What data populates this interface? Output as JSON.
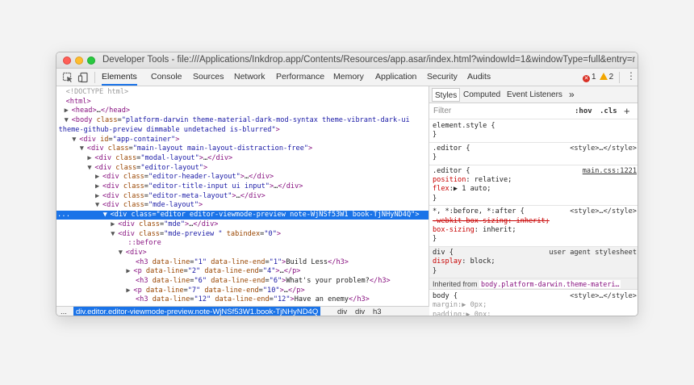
{
  "window": {
    "title": "Developer Tools - file:///Applications/Inkdrop.app/Contents/Resources/app.asar/index.html?windowId=1&windowType=full&entry=main&no..."
  },
  "toolbar": {
    "tabs": [
      "Elements",
      "Console",
      "Sources",
      "Network",
      "Performance",
      "Memory",
      "Application",
      "Security",
      "Audits"
    ],
    "errors": "1",
    "warnings": "2",
    "menu": "⋮"
  },
  "dom": {
    "rows": [
      {
        "parts": [
          [
            "comment",
            "<!DOCTYPE html>"
          ]
        ]
      },
      {
        "parts": [
          [
            "tag",
            "<html>"
          ]
        ]
      },
      {
        "parts": [
          [
            "caret",
            "▶"
          ],
          [
            "tag",
            "<head>"
          ],
          [
            "plain",
            "…"
          ],
          [
            "tag",
            "</head>"
          ]
        ]
      },
      {
        "parts": [
          [
            "caret",
            "▼"
          ],
          [
            "tag",
            "<body "
          ],
          [
            "attr",
            "class"
          ],
          [
            "plain",
            "="
          ],
          [
            "val",
            "\"platform-darwin theme-material-dark-mod-syntax theme-vibrant-dark-ui"
          ]
        ]
      },
      {
        "parts": [
          [
            "val",
            "theme-github-preview dimmable undetached is-blurred\""
          ],
          [
            "tag",
            ">"
          ]
        ]
      },
      {
        "parts": [
          [
            "caret",
            "▼"
          ],
          [
            "tag",
            "<div "
          ],
          [
            "attr",
            "id"
          ],
          [
            "plain",
            "="
          ],
          [
            "val",
            "\"app-container\""
          ],
          [
            "tag",
            ">"
          ]
        ]
      },
      {
        "parts": [
          [
            "caret",
            "▼"
          ],
          [
            "tag",
            "<div "
          ],
          [
            "attr",
            "class"
          ],
          [
            "plain",
            "="
          ],
          [
            "val",
            "\"main-layout main-layout-distraction-free\""
          ],
          [
            "tag",
            ">"
          ]
        ]
      },
      {
        "parts": [
          [
            "caret",
            "▶"
          ],
          [
            "tag",
            "<div "
          ],
          [
            "attr",
            "class"
          ],
          [
            "plain",
            "="
          ],
          [
            "val",
            "\"modal-layout\""
          ],
          [
            "tag",
            ">"
          ],
          [
            "plain",
            "…"
          ],
          [
            "tag",
            "</div>"
          ]
        ]
      },
      {
        "parts": [
          [
            "caret",
            "▼"
          ],
          [
            "tag",
            "<div "
          ],
          [
            "attr",
            "class"
          ],
          [
            "plain",
            "="
          ],
          [
            "val",
            "\"editor-layout\""
          ],
          [
            "tag",
            ">"
          ]
        ]
      },
      {
        "parts": [
          [
            "caret",
            "▶"
          ],
          [
            "tag",
            "<div "
          ],
          [
            "attr",
            "class"
          ],
          [
            "plain",
            "="
          ],
          [
            "val",
            "\"editor-header-layout\""
          ],
          [
            "tag",
            ">"
          ],
          [
            "plain",
            "…"
          ],
          [
            "tag",
            "</div>"
          ]
        ]
      },
      {
        "parts": [
          [
            "caret",
            "▶"
          ],
          [
            "tag",
            "<div "
          ],
          [
            "attr",
            "class"
          ],
          [
            "plain",
            "="
          ],
          [
            "val",
            "\"editor-title-input ui input\""
          ],
          [
            "tag",
            ">"
          ],
          [
            "plain",
            "…"
          ],
          [
            "tag",
            "</div>"
          ]
        ]
      },
      {
        "parts": [
          [
            "caret",
            "▶"
          ],
          [
            "tag",
            "<div "
          ],
          [
            "attr",
            "class"
          ],
          [
            "plain",
            "="
          ],
          [
            "val",
            "\"editor-meta-layout\""
          ],
          [
            "tag",
            ">"
          ],
          [
            "plain",
            "…"
          ],
          [
            "tag",
            "</div>"
          ]
        ]
      },
      {
        "parts": [
          [
            "caret",
            "▼"
          ],
          [
            "tag",
            "<div "
          ],
          [
            "attr",
            "class"
          ],
          [
            "plain",
            "="
          ],
          [
            "val",
            "\"mde-layout\""
          ],
          [
            "tag",
            ">"
          ]
        ]
      },
      {
        "parts": [
          [
            "caret",
            "▼"
          ],
          [
            "tag",
            "<div "
          ],
          [
            "attr",
            "class"
          ],
          [
            "plain",
            "="
          ],
          [
            "val",
            "\"editor editor-viewmode-preview note-WjNSf53W1 book-TjNHyND4Q\""
          ],
          [
            "tag",
            ">"
          ]
        ],
        "selected": true,
        "marker": "..."
      },
      {
        "parts": [
          [
            "caret",
            "▶"
          ],
          [
            "tag",
            "<div "
          ],
          [
            "attr",
            "class"
          ],
          [
            "plain",
            "="
          ],
          [
            "val",
            "\"mde\""
          ],
          [
            "tag",
            ">"
          ],
          [
            "plain",
            "…"
          ],
          [
            "tag",
            "</div>"
          ]
        ]
      },
      {
        "parts": [
          [
            "caret",
            "▼"
          ],
          [
            "tag",
            "<div "
          ],
          [
            "attr",
            "class"
          ],
          [
            "plain",
            "="
          ],
          [
            "val",
            "\"mde-preview \""
          ],
          [
            "plain",
            " "
          ],
          [
            "attr",
            "tabindex"
          ],
          [
            "plain",
            "="
          ],
          [
            "val",
            "\"0\""
          ],
          [
            "tag",
            ">"
          ]
        ]
      },
      {
        "parts": [
          [
            "pseudo",
            "::before"
          ]
        ]
      },
      {
        "parts": [
          [
            "caret",
            "▼"
          ],
          [
            "tag",
            "<div>"
          ]
        ]
      },
      {
        "parts": [
          [
            "tag",
            "<h3 "
          ],
          [
            "attr",
            "data-line"
          ],
          [
            "plain",
            "="
          ],
          [
            "val",
            "\"1\""
          ],
          [
            "plain",
            " "
          ],
          [
            "attr",
            "data-line-end"
          ],
          [
            "plain",
            "="
          ],
          [
            "val",
            "\"1\""
          ],
          [
            "tag",
            ">"
          ],
          [
            "plain",
            "Build Less"
          ],
          [
            "tag",
            "</h3>"
          ]
        ]
      },
      {
        "parts": [
          [
            "caret",
            "▶"
          ],
          [
            "tag",
            "<p "
          ],
          [
            "attr",
            "data-line"
          ],
          [
            "plain",
            "="
          ],
          [
            "val",
            "\"2\""
          ],
          [
            "plain",
            " "
          ],
          [
            "attr",
            "data-line-end"
          ],
          [
            "plain",
            "="
          ],
          [
            "val",
            "\"4\""
          ],
          [
            "tag",
            ">"
          ],
          [
            "plain",
            "…"
          ],
          [
            "tag",
            "</p>"
          ]
        ]
      },
      {
        "parts": [
          [
            "tag",
            "<h3 "
          ],
          [
            "attr",
            "data-line"
          ],
          [
            "plain",
            "="
          ],
          [
            "val",
            "\"6\""
          ],
          [
            "plain",
            " "
          ],
          [
            "attr",
            "data-line-end"
          ],
          [
            "plain",
            "="
          ],
          [
            "val",
            "\"6\""
          ],
          [
            "tag",
            ">"
          ],
          [
            "plain",
            "What's your problem?"
          ],
          [
            "tag",
            "</h3>"
          ]
        ]
      },
      {
        "parts": [
          [
            "caret",
            "▶"
          ],
          [
            "tag",
            "<p "
          ],
          [
            "attr",
            "data-line"
          ],
          [
            "plain",
            "="
          ],
          [
            "val",
            "\"7\""
          ],
          [
            "plain",
            " "
          ],
          [
            "attr",
            "data-line-end"
          ],
          [
            "plain",
            "="
          ],
          [
            "val",
            "\"10\""
          ],
          [
            "tag",
            ">"
          ],
          [
            "plain",
            "…"
          ],
          [
            "tag",
            "</p>"
          ]
        ]
      },
      {
        "parts": [
          [
            "tag",
            "<h3 "
          ],
          [
            "attr",
            "data-line"
          ],
          [
            "plain",
            "="
          ],
          [
            "val",
            "\"12\""
          ],
          [
            "plain",
            " "
          ],
          [
            "attr",
            "data-line-end"
          ],
          [
            "plain",
            "="
          ],
          [
            "val",
            "\"12\""
          ],
          [
            "tag",
            ">"
          ],
          [
            "plain",
            "Have an enemy"
          ],
          [
            "tag",
            "</h3>"
          ]
        ]
      }
    ]
  },
  "breadcrumbs": [
    "...",
    "div.editor.editor-viewmode-preview.note-WjNSf53W1.book-TjNHyND4Q",
    "div",
    "div",
    "h3"
  ],
  "styles": {
    "tabs": [
      "Styles",
      "Computed",
      "Event Listeners",
      "»"
    ],
    "filter_placeholder": "Filter",
    "hov": ":hov",
    "cls": ".cls",
    "add": "+",
    "blocks": [
      {
        "lines": [
          {
            "text": [
              [
                "sel",
                "element.style {"
              ]
            ]
          },
          {
            "text": [
              [
                "sel",
                "}"
              ]
            ]
          }
        ]
      },
      {
        "lines": [
          {
            "text": [
              [
                "sel",
                ".editor {"
              ]
            ],
            "right": "<style>…</style>"
          },
          {
            "text": [
              [
                "sel",
                "}"
              ]
            ]
          }
        ]
      },
      {
        "lines": [
          {
            "text": [
              [
                "sel",
                ".editor {"
              ]
            ],
            "right": "main.css:1221",
            "link": true
          },
          {
            "text": [
              [
                "indent",
                "  "
              ],
              [
                "prop",
                "position"
              ],
              [
                "pval",
                ": relative;"
              ]
            ]
          },
          {
            "text": [
              [
                "indent",
                "  "
              ],
              [
                "prop",
                "flex"
              ],
              [
                "pval",
                ":▶ 1 auto;"
              ]
            ]
          },
          {
            "text": [
              [
                "sel",
                "}"
              ]
            ]
          }
        ]
      },
      {
        "lines": [
          {
            "text": [
              [
                "sel",
                "*, *:before, *:after {"
              ]
            ],
            "right": "<style>…</style>"
          },
          {
            "text": [
              [
                "indent",
                "  "
              ],
              [
                "strike",
                "-webkit-box-sizing: inherit;"
              ]
            ]
          },
          {
            "text": [
              [
                "indent",
                "  "
              ],
              [
                "prop",
                "box-sizing"
              ],
              [
                "pval",
                ": inherit;"
              ]
            ]
          },
          {
            "text": [
              [
                "sel",
                "}"
              ]
            ]
          }
        ]
      },
      {
        "ua": true,
        "lines": [
          {
            "text": [
              [
                "sel",
                "div {"
              ]
            ],
            "right": "user agent stylesheet"
          },
          {
            "text": [
              [
                "indent",
                "  "
              ],
              [
                "prop",
                "display"
              ],
              [
                "pval",
                ": block;"
              ]
            ]
          },
          {
            "text": [
              [
                "sel",
                "}"
              ]
            ]
          }
        ]
      }
    ],
    "inherited_label": "Inherited from",
    "inherited_from": "body.platform-darwin.theme-materi…",
    "body_block": [
      {
        "text": [
          [
            "sel",
            "body {"
          ]
        ],
        "right": "<style>…</style>"
      },
      {
        "text": [
          [
            "indent",
            "  "
          ],
          [
            "gprop",
            "margin"
          ],
          [
            "gval",
            ":▶ 0px;"
          ]
        ]
      },
      {
        "text": [
          [
            "indent",
            "  "
          ],
          [
            "gprop",
            "padding"
          ],
          [
            "gval",
            ":▶ 0px;"
          ]
        ]
      }
    ]
  }
}
